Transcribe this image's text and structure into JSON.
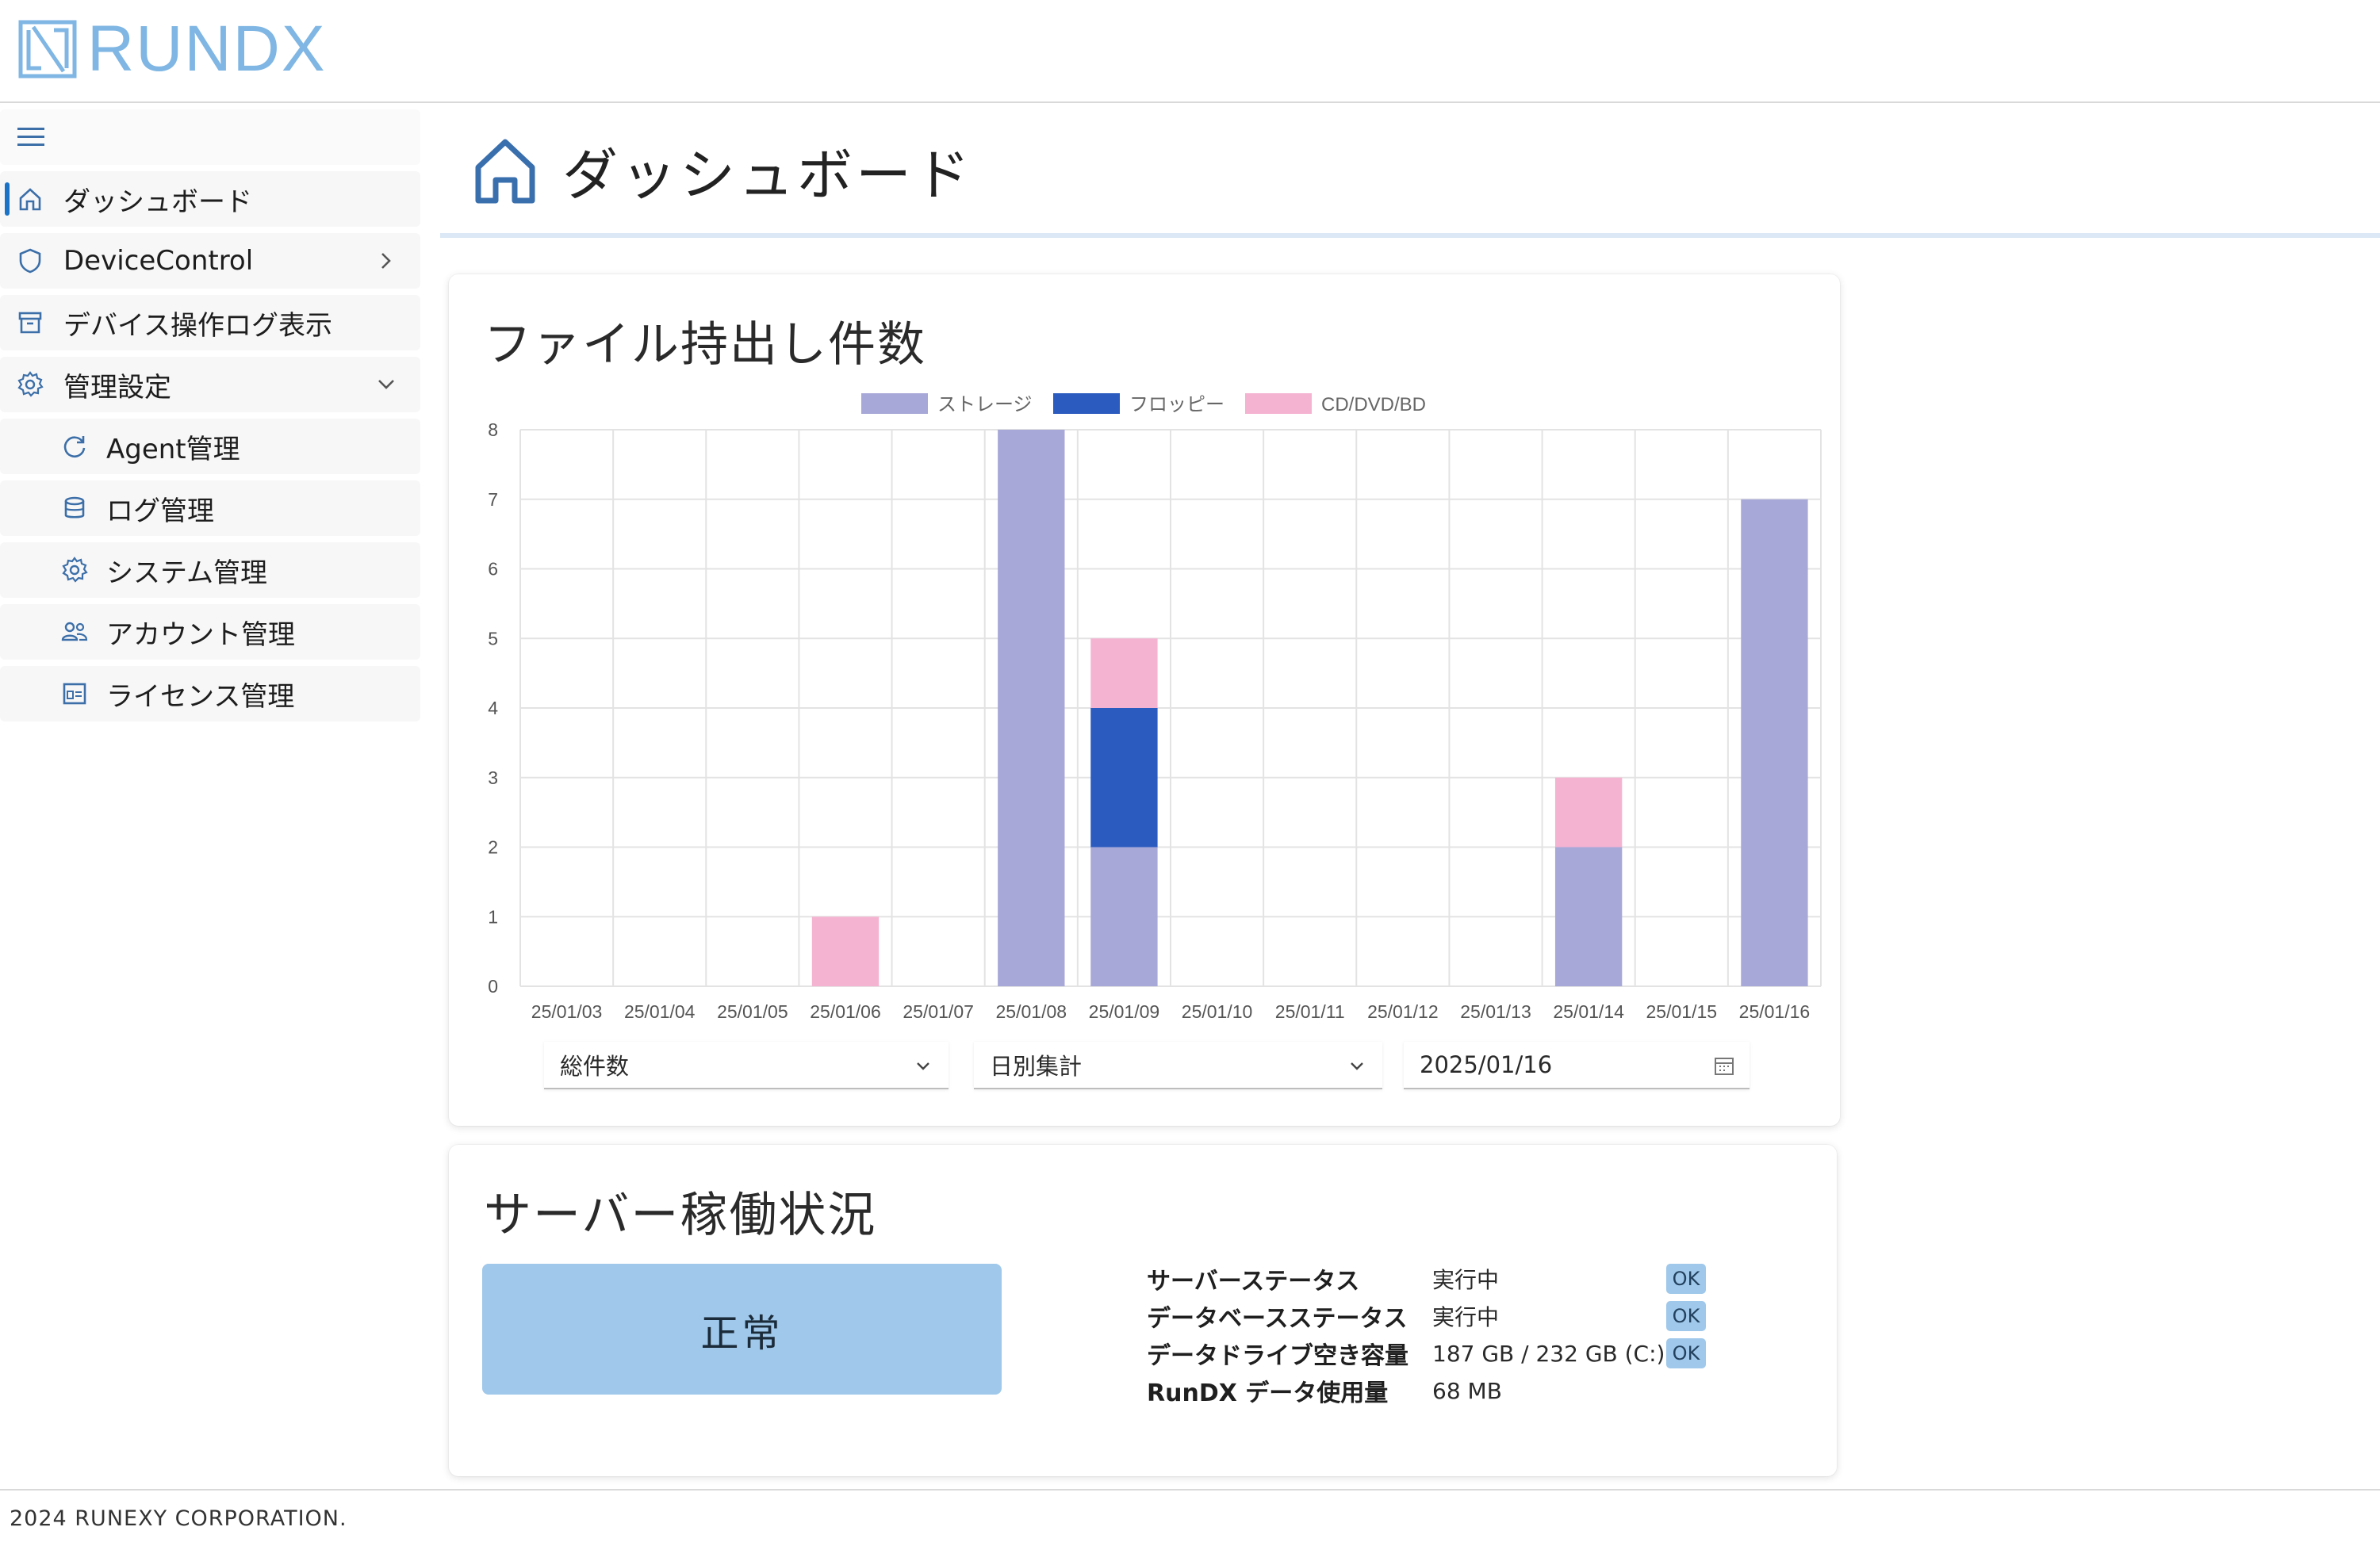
{
  "app": {
    "logo_text": "RUNDX"
  },
  "sidebar": {
    "items": [
      {
        "label": "ダッシュボード",
        "icon": "home-icon"
      },
      {
        "label": "DeviceControl",
        "icon": "shield-icon"
      },
      {
        "label": "デバイス操作ログ表示",
        "icon": "archive-icon"
      },
      {
        "label": "管理設定",
        "icon": "gear-icon"
      },
      {
        "label": "Agent管理",
        "icon": "refresh-icon"
      },
      {
        "label": "ログ管理",
        "icon": "database-icon"
      },
      {
        "label": "システム管理",
        "icon": "gear-icon"
      },
      {
        "label": "アカウント管理",
        "icon": "users-icon"
      },
      {
        "label": "ライセンス管理",
        "icon": "license-icon"
      }
    ]
  },
  "page": {
    "title": "ダッシュボード"
  },
  "file_card": {
    "title": "ファイル持出し件数",
    "count_select": "総件数",
    "period_select": "日別集計",
    "date_value": "2025/01/16"
  },
  "chart_data": {
    "type": "bar",
    "stacked": true,
    "categories": [
      "25/01/03",
      "25/01/04",
      "25/01/05",
      "25/01/06",
      "25/01/07",
      "25/01/08",
      "25/01/09",
      "25/01/10",
      "25/01/11",
      "25/01/12",
      "25/01/13",
      "25/01/14",
      "25/01/15",
      "25/01/16"
    ],
    "series": [
      {
        "name": "ストレージ",
        "color": "#a8a8d8",
        "values": [
          0,
          0,
          0,
          0,
          0,
          8,
          2,
          0,
          0,
          0,
          0,
          2,
          0,
          7
        ]
      },
      {
        "name": "フロッピー",
        "color": "#2b5bbf",
        "values": [
          0,
          0,
          0,
          0,
          0,
          0,
          2,
          0,
          0,
          0,
          0,
          0,
          0,
          0
        ]
      },
      {
        "name": "CD/DVD/BD",
        "color": "#f5b3d2",
        "values": [
          0,
          0,
          0,
          1,
          0,
          0,
          1,
          0,
          0,
          0,
          0,
          1,
          0,
          0
        ]
      }
    ],
    "ylim": [
      0,
      8
    ],
    "yticks": [
      0,
      1,
      2,
      3,
      4,
      5,
      6,
      7,
      8
    ],
    "grid": true,
    "legend": "top-center"
  },
  "server_card": {
    "title": "サーバー稼働状況",
    "overall": "正常",
    "rows": [
      {
        "label": "サーバーステータス",
        "value": "実行中",
        "badge": "OK"
      },
      {
        "label": "データベースステータス",
        "value": "実行中",
        "badge": "OK"
      },
      {
        "label": "データドライブ空き容量",
        "value": "187 GB / 232 GB (C:)",
        "badge": "OK"
      },
      {
        "label": "RunDX データ使用量",
        "value": "68 MB",
        "badge": ""
      }
    ]
  },
  "footer": {
    "copyright": "2024 RUNEXY CORPORATION."
  }
}
